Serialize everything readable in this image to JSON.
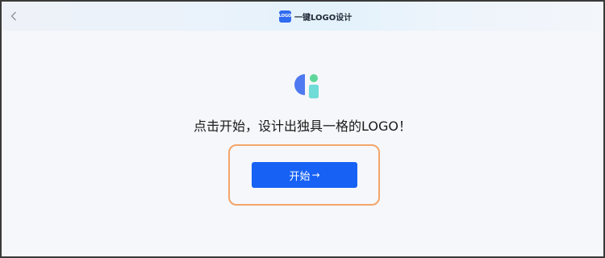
{
  "header": {
    "brand_mark_text": "LOGO",
    "title": "一键LOGO设计"
  },
  "main": {
    "headline": "点击开始，设计出独具一格的LOGO！",
    "start_button_label": "开始",
    "start_button_arrow": "→"
  },
  "colors": {
    "accent": "#1762f5",
    "highlight_border": "#f3a56a",
    "icon_blue": "#4f79f0",
    "icon_green": "#5fd79a",
    "icon_teal": "#6fdcd7"
  }
}
